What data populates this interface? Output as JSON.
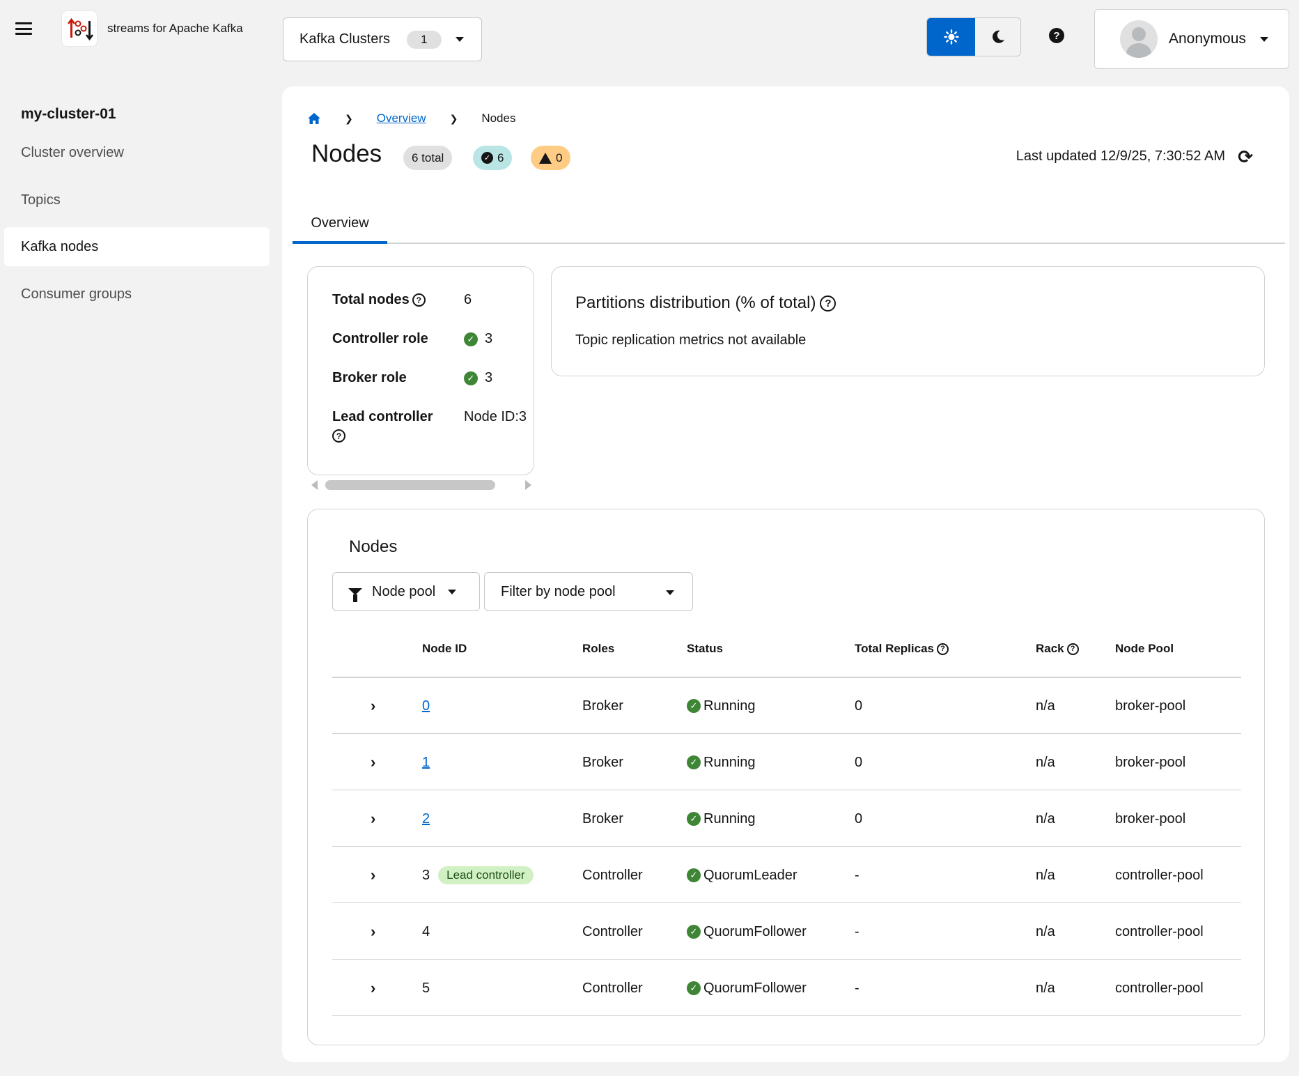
{
  "header": {
    "brand": "streams for Apache Kafka",
    "cluster_selector": {
      "label": "Kafka Clusters",
      "count": "1"
    },
    "theme": {
      "light_icon": "sun-icon",
      "dark_icon": "moon-icon",
      "active": "light"
    },
    "help_icon": "question-circle-icon",
    "user": {
      "name": "Anonymous"
    }
  },
  "sidebar": {
    "cluster_name": "my-cluster-01",
    "items": [
      {
        "label": "Cluster overview",
        "active": false
      },
      {
        "label": "Topics",
        "active": false
      },
      {
        "label": "Kafka nodes",
        "active": true
      },
      {
        "label": "Consumer groups",
        "active": false
      }
    ]
  },
  "breadcrumb": {
    "home_icon": "home-icon",
    "overview": "Overview",
    "current": "Nodes"
  },
  "page": {
    "title": "Nodes",
    "badges": {
      "total": "6 total",
      "ok": "6",
      "warn": "0"
    },
    "last_updated": "Last updated 12/9/25, 7:30:52 AM",
    "tabs": [
      "Overview"
    ]
  },
  "summary": {
    "total_nodes_label": "Total nodes",
    "total_nodes": "6",
    "controller_label": "Controller role",
    "controller": "3",
    "broker_label": "Broker role",
    "broker": "3",
    "lead_label": "Lead controller",
    "lead": "Node ID:3"
  },
  "partitions": {
    "title": "Partitions distribution (% of total)",
    "message": "Topic replication metrics not available"
  },
  "nodes_table": {
    "title": "Nodes",
    "filter_attr": "Node pool",
    "filter_placeholder": "Filter by node pool",
    "columns": [
      "Node ID",
      "Roles",
      "Status",
      "Total Replicas",
      "Rack",
      "Node Pool"
    ],
    "rows": [
      {
        "id": "0",
        "link": true,
        "tag": "",
        "role": "Broker",
        "status": "Running",
        "replicas": "0",
        "rack": "n/a",
        "pool": "broker-pool"
      },
      {
        "id": "1",
        "link": true,
        "tag": "",
        "role": "Broker",
        "status": "Running",
        "replicas": "0",
        "rack": "n/a",
        "pool": "broker-pool"
      },
      {
        "id": "2",
        "link": true,
        "tag": "",
        "role": "Broker",
        "status": "Running",
        "replicas": "0",
        "rack": "n/a",
        "pool": "broker-pool"
      },
      {
        "id": "3",
        "link": false,
        "tag": "Lead controller",
        "role": "Controller",
        "status": "QuorumLeader",
        "replicas": "-",
        "rack": "n/a",
        "pool": "controller-pool"
      },
      {
        "id": "4",
        "link": false,
        "tag": "",
        "role": "Controller",
        "status": "QuorumFollower",
        "replicas": "-",
        "rack": "n/a",
        "pool": "controller-pool"
      },
      {
        "id": "5",
        "link": false,
        "tag": "",
        "role": "Controller",
        "status": "QuorumFollower",
        "replicas": "-",
        "rack": "n/a",
        "pool": "controller-pool"
      }
    ]
  },
  "colors": {
    "accent": "#0066cc",
    "success": "#3e8635",
    "warning": "#ffcc85",
    "info": "#b9e5e5"
  }
}
